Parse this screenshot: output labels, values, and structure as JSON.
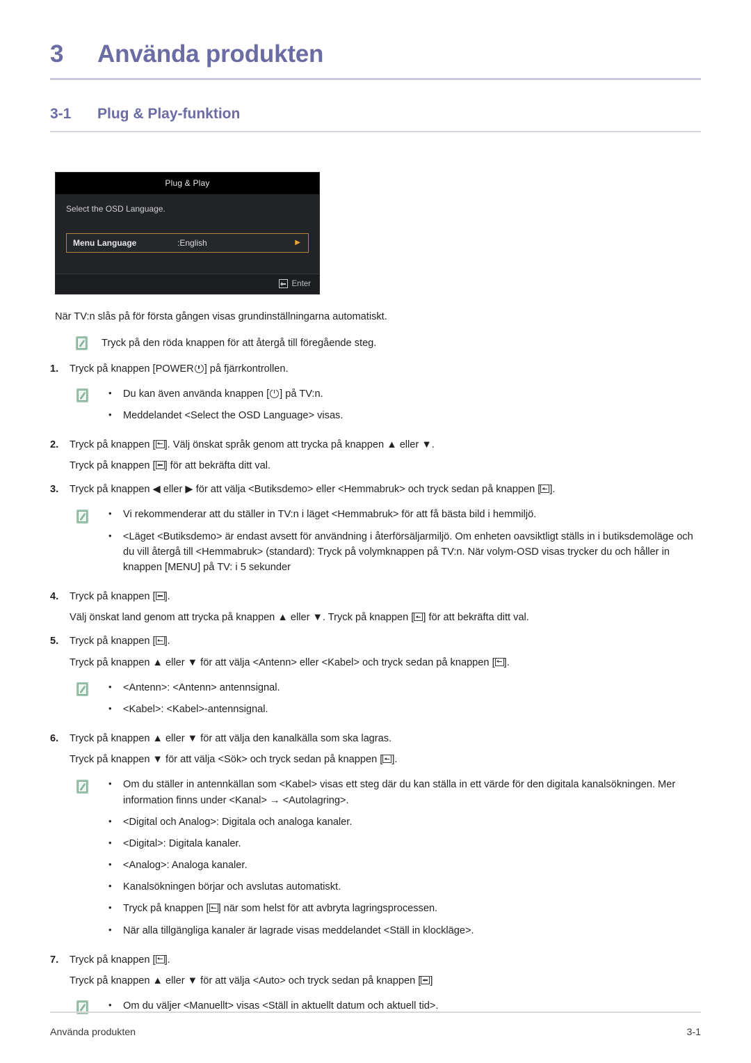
{
  "chapter": {
    "number": "3",
    "title": "Använda produkten"
  },
  "section": {
    "number": "3-1",
    "title": "Plug & Play-funktion"
  },
  "osd": {
    "title": "Plug & Play",
    "prompt": "Select the OSD Language.",
    "row_label": "Menu Language",
    "row_value": ":English",
    "row_arrow": "▶",
    "footer_label": "Enter",
    "accent_border": "#b2863f",
    "accent_arrow": "#e8a33d",
    "title_bg": "#000000",
    "body_bg": "#232428"
  },
  "intro": "När TV:n slås på för första gången visas grundinställningarna automatiskt.",
  "top_note": "Tryck på den röda knappen för att återgå till föregående steg.",
  "steps": [
    {
      "num": "1.",
      "lines_pre": "Tryck på knappen [POWER",
      "lines_post": "] på fjärrkontrollen.",
      "notes": [
        "Du kan även använda knappen [",
        "] på TV:n.",
        "Meddelandet <Select the OSD Language> visas."
      ]
    },
    {
      "num": "2.",
      "line1_a": "Tryck på knappen [",
      "line1_b": "]. Välj önskat språk genom att trycka på knappen ▲ eller ▼.",
      "line2_a": "Tryck på knappen [",
      "line2_b": "] för att bekräfta ditt val."
    },
    {
      "num": "3.",
      "line1_a": "Tryck på knappen ◀ eller ▶ för att välja <Butiksdemo> eller <Hemmabruk> och tryck sedan på knappen [",
      "line1_b": "].",
      "notes": [
        "Vi rekommenderar att du ställer in TV:n i läget <Hemmabruk> för att få bästa bild i hemmiljö.",
        "<Läget <Butiksdemo> är endast avsett för användning i återförsäljarmiljö. Om enheten oavsiktligt ställs in i butiksdemoläge och du vill återgå till <Hemmabruk> (standard): Tryck på volymknappen på TV:n. När volym-OSD visas trycker du och håller in knappen [MENU] på TV: i 5 sekunder"
      ]
    },
    {
      "num": "4.",
      "line1_a": "Tryck på knappen [",
      "line1_b": "].",
      "line2_a": "Välj önskat land genom att trycka på knappen ▲ eller ▼. Tryck på knappen [",
      "line2_b": "] för att bekräfta ditt val."
    },
    {
      "num": "5.",
      "line1_a": "Tryck på knappen [",
      "line1_b": "].",
      "line2_a": "Tryck på knappen ▲ eller ▼ för att välja <Antenn> eller <Kabel> och tryck sedan på knappen [",
      "line2_b": "].",
      "notes": [
        "<Antenn>: <Antenn> antennsignal.",
        "<Kabel>: <Kabel>-antennsignal."
      ]
    },
    {
      "num": "6.",
      "line1": "Tryck på knappen ▲ eller ▼ för att välja den kanalkälla som ska lagras.",
      "line2_a": "Tryck på knappen ▼ för att välja <Sök> och tryck sedan på knappen [",
      "line2_b": "].",
      "notes": [
        "Om du ställer in antennkällan som <Kabel> visas ett steg där du kan ställa in ett värde för den digitala kanalsökningen. Mer information finns under <Kanal> → <Autolagring>.",
        "<Digital och Analog>: Digitala och analoga kanaler.",
        "<Digital>: Digitala kanaler.",
        "<Analog>: Analoga kanaler.",
        "Kanalsökningen börjar och avslutas automatiskt.",
        "Tryck på knappen [",
        "] när som helst för att avbryta lagringsprocessen.",
        "När alla tillgängliga kanaler är lagrade visas meddelandet <Ställ in klockläge>."
      ]
    },
    {
      "num": "7.",
      "line1_a": "Tryck på knappen [",
      "line1_b": "].",
      "line2_a": "Tryck på knappen ▲ eller ▼ för att välja <Auto> och tryck sedan på knappen [",
      "line2_b": "]",
      "notes": [
        "Om du väljer <Manuellt> visas <Ställ in aktuellt datum och aktuell tid>."
      ]
    }
  ],
  "bullet_char": "•",
  "footer": {
    "left": "Använda produkten",
    "right": "3-1"
  }
}
